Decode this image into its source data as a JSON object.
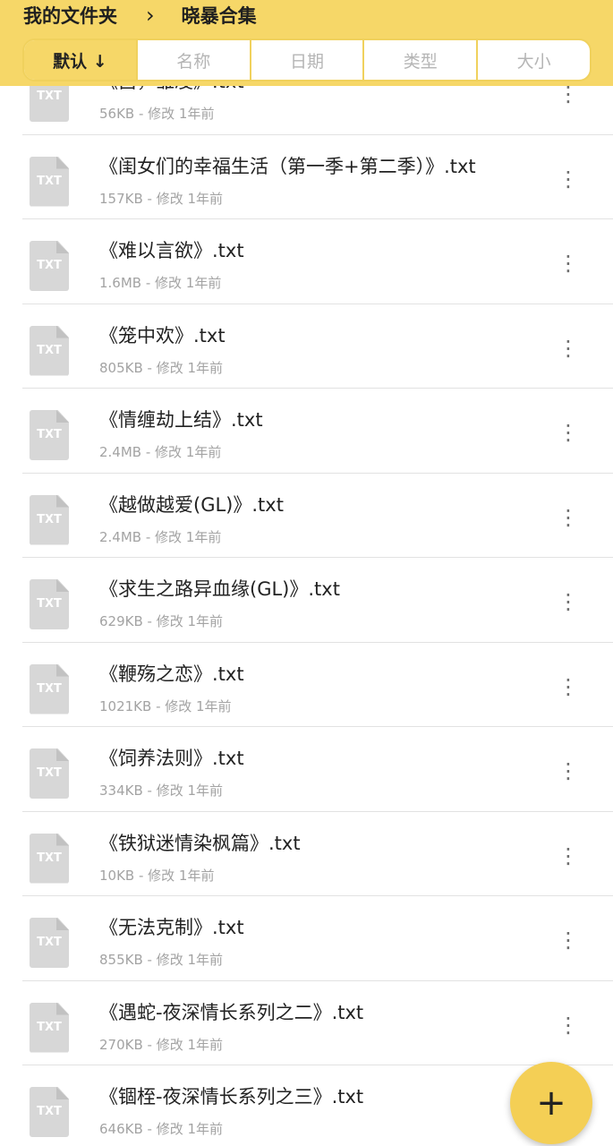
{
  "breadcrumb": {
    "parent": "我的文件夹",
    "separator": "›",
    "current": "晓暴合集"
  },
  "sort_tabs": [
    {
      "label": "默认 ↓"
    },
    {
      "label": "名称"
    },
    {
      "label": "日期"
    },
    {
      "label": "类型"
    },
    {
      "label": "大小"
    }
  ],
  "files": [
    {
      "icon_label": "TXT",
      "name": "《吕，雏凌》.txt",
      "meta": "56KB - 修改 1年前"
    },
    {
      "icon_label": "TXT",
      "name": "《闺女们的幸福生活（第一季+第二季）》.txt",
      "meta": "157KB - 修改 1年前"
    },
    {
      "icon_label": "TXT",
      "name": "《难以言欲》.txt",
      "meta": "1.6MB - 修改 1年前"
    },
    {
      "icon_label": "TXT",
      "name": "《笼中欢》.txt",
      "meta": "805KB - 修改 1年前"
    },
    {
      "icon_label": "TXT",
      "name": "《情缠劫上结》.txt",
      "meta": "2.4MB - 修改 1年前"
    },
    {
      "icon_label": "TXT",
      "name": "《越做越爱(GL)》.txt",
      "meta": "2.4MB - 修改 1年前"
    },
    {
      "icon_label": "TXT",
      "name": "《求生之路异血缘(GL)》.txt",
      "meta": "629KB - 修改 1年前"
    },
    {
      "icon_label": "TXT",
      "name": "《鞭殇之恋》.txt",
      "meta": "1021KB - 修改 1年前"
    },
    {
      "icon_label": "TXT",
      "name": "《饲养法则》.txt",
      "meta": "334KB - 修改 1年前"
    },
    {
      "icon_label": "TXT",
      "name": "《铁狱迷情染枫篇》.txt",
      "meta": "10KB - 修改 1年前"
    },
    {
      "icon_label": "TXT",
      "name": "《无法克制》.txt",
      "meta": "855KB - 修改 1年前"
    },
    {
      "icon_label": "TXT",
      "name": "《遇蛇-夜深情长系列之二》.txt",
      "meta": "270KB - 修改 1年前"
    },
    {
      "icon_label": "TXT",
      "name": "《锢桎-夜深情长系列之三》.txt",
      "meta": "646KB - 修改 1年前"
    }
  ],
  "more_glyph": "⋮",
  "fab": {
    "label": "+",
    "icon": "plus-icon"
  }
}
